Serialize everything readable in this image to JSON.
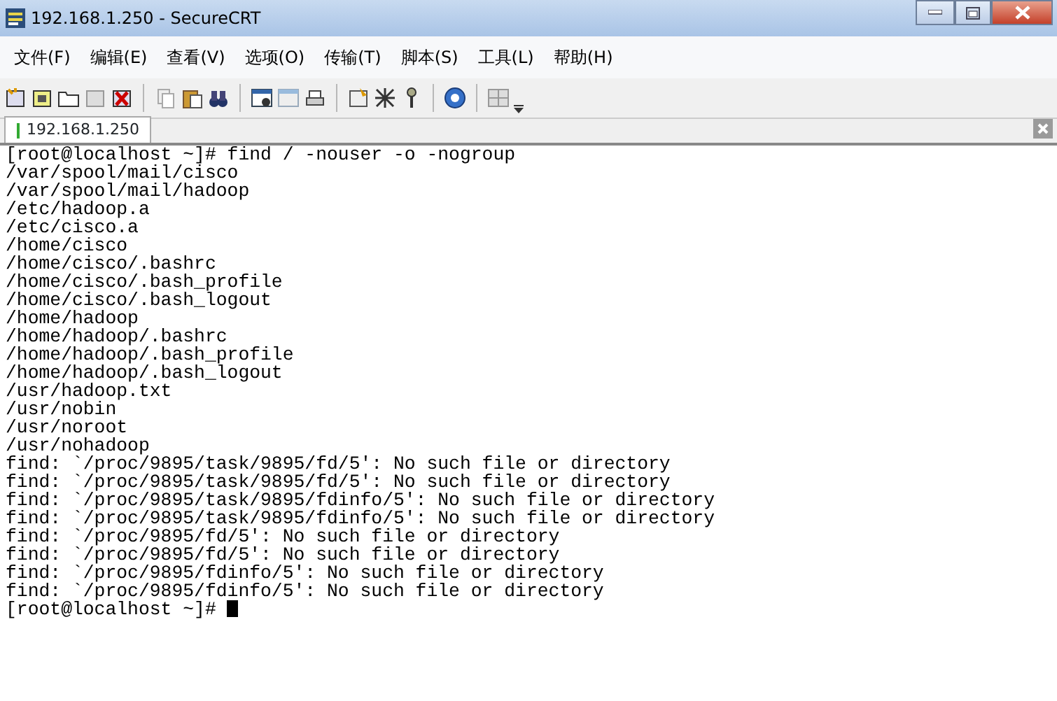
{
  "window": {
    "title": "192.168.1.250 - SecureCRT"
  },
  "menu": [
    "文件(F)",
    "编辑(E)",
    "查看(V)",
    "选项(O)",
    "传输(T)",
    "脚本(S)",
    "工具(L)",
    "帮助(H)"
  ],
  "tabs": [
    {
      "label": "192.168.1.250",
      "selected": true
    }
  ],
  "terminal": {
    "lines": [
      "[root@localhost ~]# find / -nouser -o -nogroup",
      "/var/spool/mail/cisco",
      "/var/spool/mail/hadoop",
      "/etc/hadoop.a",
      "/etc/cisco.a",
      "/home/cisco",
      "/home/cisco/.bashrc",
      "/home/cisco/.bash_profile",
      "/home/cisco/.bash_logout",
      "/home/hadoop",
      "/home/hadoop/.bashrc",
      "/home/hadoop/.bash_profile",
      "/home/hadoop/.bash_logout",
      "/usr/hadoop.txt",
      "/usr/nobin",
      "/usr/noroot",
      "/usr/nohadoop",
      "find: `/proc/9895/task/9895/fd/5': No such file or directory",
      "find: `/proc/9895/task/9895/fd/5': No such file or directory",
      "find: `/proc/9895/task/9895/fdinfo/5': No such file or directory",
      "find: `/proc/9895/task/9895/fdinfo/5': No such file or directory",
      "find: `/proc/9895/fd/5': No such file or directory",
      "find: `/proc/9895/fd/5': No such file or directory",
      "find: `/proc/9895/fdinfo/5': No such file or directory",
      "find: `/proc/9895/fdinfo/5': No such file or directory",
      "[root@localhost ~]# "
    ],
    "cursor": true
  }
}
